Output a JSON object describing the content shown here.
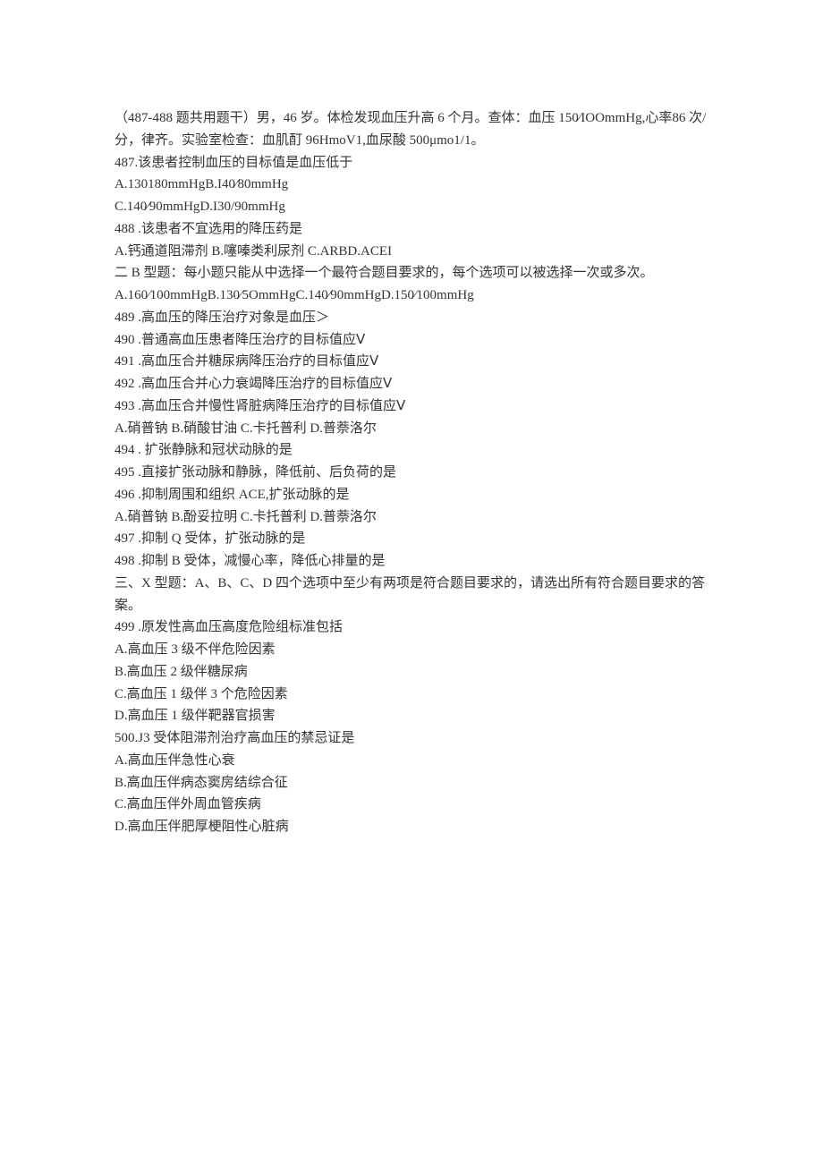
{
  "lines": [
    "（487-488 题共用题干）男，46 岁。体检发现血压升高 6 个月。查体：血压 150∕IOOmmHg,心率86 次/分，律齐。实验室检查：血肌酊 96HmoV1,血尿酸 500μmo1/1。",
    "487.该患者控制血压的目标值是血压低于",
    "A.130180mmHgB.I40∕80mmHg",
    "C.140∕90mmHgD.I30/90mmHg",
    "488  .该患者不宜选用的降压药是",
    "A.钙通道阻滞剂 B.噻嗪类利尿剂 C.ARBD.ACEI",
    "二 B 型题：每小题只能从中选择一个最符合题目要求的，每个选项可以被选择一次或多次。",
    "A.160∕100mmHgB.130∕5OmmHgC.140∕90mmHgD.150∕100mmHg",
    "489  .高血压的降压治疗对象是血压＞",
    "490  .普通高血压患者降压治疗的目标值应Ⅴ",
    "491  .高血压合并糖尿病降压治疗的目标值应Ⅴ",
    "492  .高血压合并心力衰竭降压治疗的目标值应Ⅴ",
    "493  .高血压合并慢性肾脏病降压治疗的目标值应Ⅴ",
    "A.硝普钠 B.硝酸甘油 C.卡托普利 D.普萘洛尔",
    "494  . 扩张静脉和冠状动脉的是",
    "495  .直接扩张动脉和静脉，降低前、后负荷的是",
    "496  .抑制周围和组织 ACE,扩张动脉的是",
    "A.硝普钠 B.酚妥拉明 C.卡托普利 D.普萘洛尔",
    "497  .抑制 Q 受体，扩张动脉的是",
    "498  .抑制 B 受体，减慢心率，降低心排量的是",
    "三、X 型题：A、B、C、D 四个选项中至少有两项是符合题目要求的，请选出所有符合题目要求的答案。",
    "499  .原发性高血压高度危险组标准包括",
    "A.高血压 3 级不伴危险因素",
    "B.高血压 2 级伴糖尿病",
    "C.高血压 1 级伴 3 个危险因素",
    "D.高血压 1 级伴靶器官损害",
    "500.J3 受体阻滞剂治疗高血压的禁忌证是",
    "A.高血压伴急性心衰",
    "B.高血压伴病态窦房结综合征",
    "C.高血压伴外周血管疾病",
    "D.高血压伴肥厚梗阻性心脏病"
  ]
}
